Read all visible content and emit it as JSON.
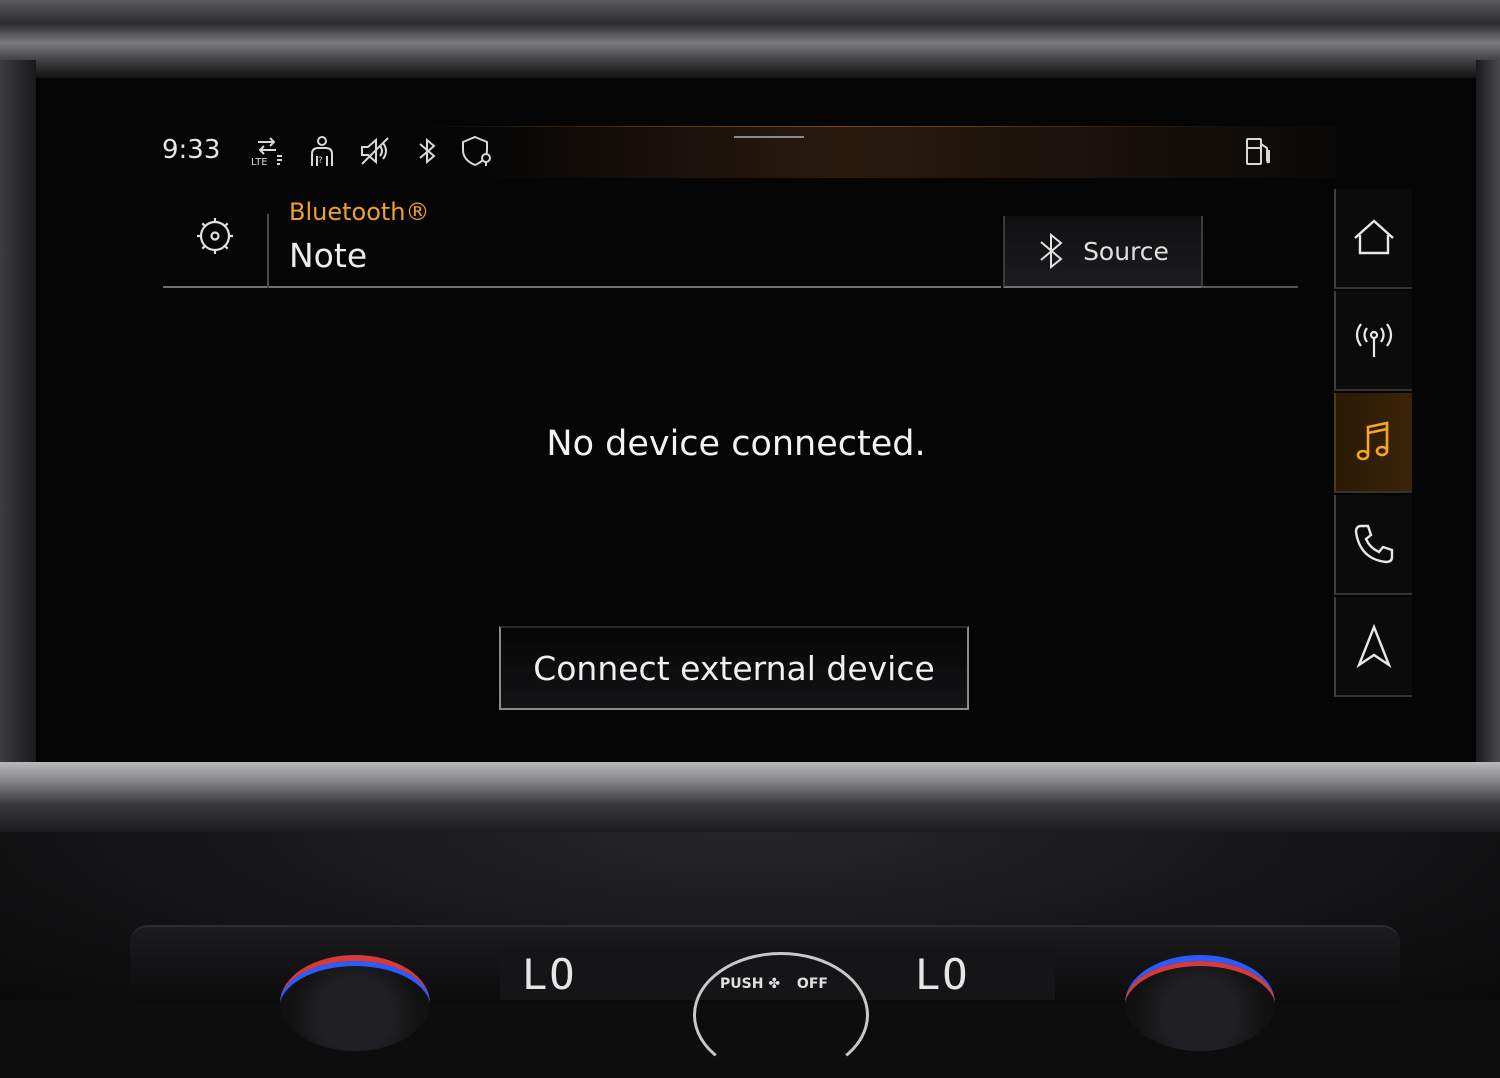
{
  "status_bar": {
    "time": "9:33",
    "icons": [
      "lte-data-icon",
      "person-seat-icon",
      "speaker-muted-icon",
      "bluetooth-icon",
      "shield-location-icon",
      "fuel-icon"
    ],
    "lte_label": "LTE"
  },
  "header": {
    "source_name": "Bluetooth®",
    "track_title": "Note",
    "source_button_label": "Source"
  },
  "main": {
    "message": "No device connected.",
    "connect_button_label": "Connect external device"
  },
  "nav": {
    "items": [
      {
        "name": "home",
        "active": false
      },
      {
        "name": "radio",
        "active": false
      },
      {
        "name": "media",
        "active": true
      },
      {
        "name": "phone",
        "active": false
      },
      {
        "name": "navigation",
        "active": false
      }
    ]
  },
  "climate": {
    "left_temp": "LO",
    "right_temp": "LO",
    "fan_push_label": "PUSH",
    "fan_off_label": "OFF"
  },
  "colors": {
    "accent": "#f0a030",
    "active_nav_bg": "#3a2408",
    "screen_bg": "#050506"
  }
}
